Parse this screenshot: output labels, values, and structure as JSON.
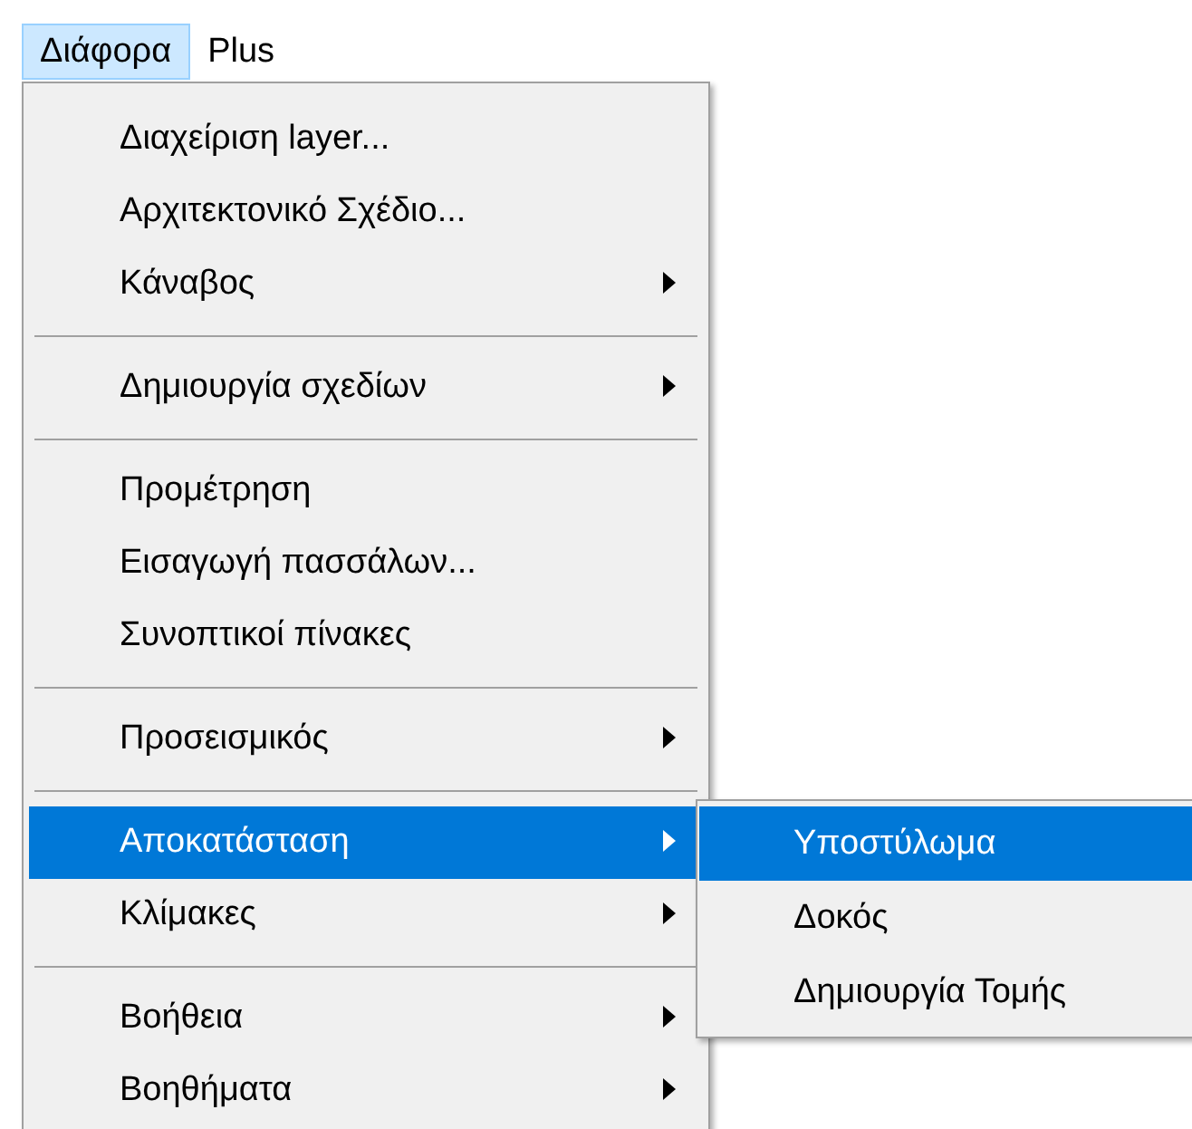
{
  "menubar": [
    {
      "label": "Διάφορα",
      "selected": true
    },
    {
      "label": "Plus",
      "selected": false
    }
  ],
  "menu": {
    "items": [
      {
        "kind": "item",
        "label": "Διαχείριση layer...",
        "has_submenu": false,
        "selected": false
      },
      {
        "kind": "item",
        "label": "Αρχιτεκτονικό Σχέδιο...",
        "has_submenu": false,
        "selected": false
      },
      {
        "kind": "item",
        "label": "Κάναβος",
        "has_submenu": true,
        "selected": false
      },
      {
        "kind": "separator"
      },
      {
        "kind": "item",
        "label": "Δημιουργία σχεδίων",
        "has_submenu": true,
        "selected": false
      },
      {
        "kind": "separator"
      },
      {
        "kind": "item",
        "label": "Προμέτρηση",
        "has_submenu": false,
        "selected": false
      },
      {
        "kind": "item",
        "label": "Εισαγωγή πασσάλων...",
        "has_submenu": false,
        "selected": false
      },
      {
        "kind": "item",
        "label": "Συνοπτικοί πίνακες",
        "has_submenu": false,
        "selected": false
      },
      {
        "kind": "separator"
      },
      {
        "kind": "item",
        "label": "Προσεισμικός",
        "has_submenu": true,
        "selected": false
      },
      {
        "kind": "separator"
      },
      {
        "kind": "item",
        "label": "Αποκατάσταση",
        "has_submenu": true,
        "selected": true,
        "submenu": [
          {
            "label": "Υποστύλωμα",
            "selected": true
          },
          {
            "label": "Δοκός",
            "selected": false
          },
          {
            "label": "Δημιουργία Τομής",
            "selected": false
          }
        ]
      },
      {
        "kind": "item",
        "label": "Κλίμακες",
        "has_submenu": true,
        "selected": false
      },
      {
        "kind": "separator"
      },
      {
        "kind": "item",
        "label": "Βοήθεια",
        "has_submenu": true,
        "selected": false
      },
      {
        "kind": "item",
        "label": "Βοηθήματα",
        "has_submenu": true,
        "selected": false
      }
    ]
  }
}
